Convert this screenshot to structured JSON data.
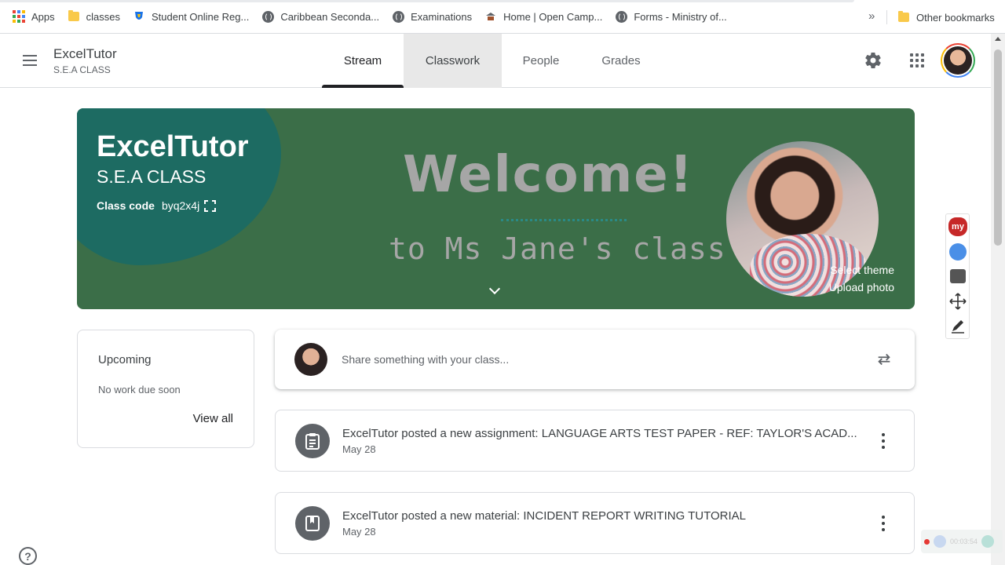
{
  "bookmarks": {
    "items": [
      {
        "label": "Apps",
        "icon": "apps-grid-icon"
      },
      {
        "label": "classes",
        "icon": "folder-icon"
      },
      {
        "label": "Student Online Reg...",
        "icon": "coat-of-arms-icon"
      },
      {
        "label": "Caribbean Seconda...",
        "icon": "globe-icon"
      },
      {
        "label": "Examinations",
        "icon": "globe-icon"
      },
      {
        "label": "Home | Open Camp...",
        "icon": "open-campus-icon"
      },
      {
        "label": "Forms - Ministry of...",
        "icon": "globe-icon"
      }
    ],
    "more": "»",
    "other": "Other bookmarks"
  },
  "header": {
    "title": "ExcelTutor",
    "subtitle": "S.E.A CLASS",
    "tabs": [
      {
        "label": "Stream",
        "state": "active"
      },
      {
        "label": "Classwork",
        "state": "hover"
      },
      {
        "label": "People",
        "state": "normal"
      },
      {
        "label": "Grades",
        "state": "normal"
      }
    ]
  },
  "banner": {
    "title": "ExcelTutor",
    "subtitle": "S.E.A CLASS",
    "class_code_label": "Class code",
    "class_code": "byq2x4j",
    "welcome_line1": "Welcome!",
    "welcome_line2": "to Ms Jane's class",
    "select_theme": "Select theme",
    "upload_photo": "Upload photo",
    "colors": {
      "background": "#3b6e48",
      "blob": "#1d6b62"
    }
  },
  "upcoming": {
    "title": "Upcoming",
    "body": "No work due soon",
    "link": "View all"
  },
  "share": {
    "placeholder": "Share something with your class..."
  },
  "posts": [
    {
      "title": "ExcelTutor posted a new assignment: LANGUAGE ARTS TEST PAPER - REF: TAYLOR'S ACAD...",
      "date": "May 28",
      "icon": "assignment-icon"
    },
    {
      "title": "ExcelTutor posted a new material: INCIDENT REPORT WRITING TUTORIAL",
      "date": "May 28",
      "icon": "material-book-icon"
    }
  ],
  "extensions": {
    "my_label": "my"
  },
  "recorder": {
    "time": "00:03:54"
  }
}
